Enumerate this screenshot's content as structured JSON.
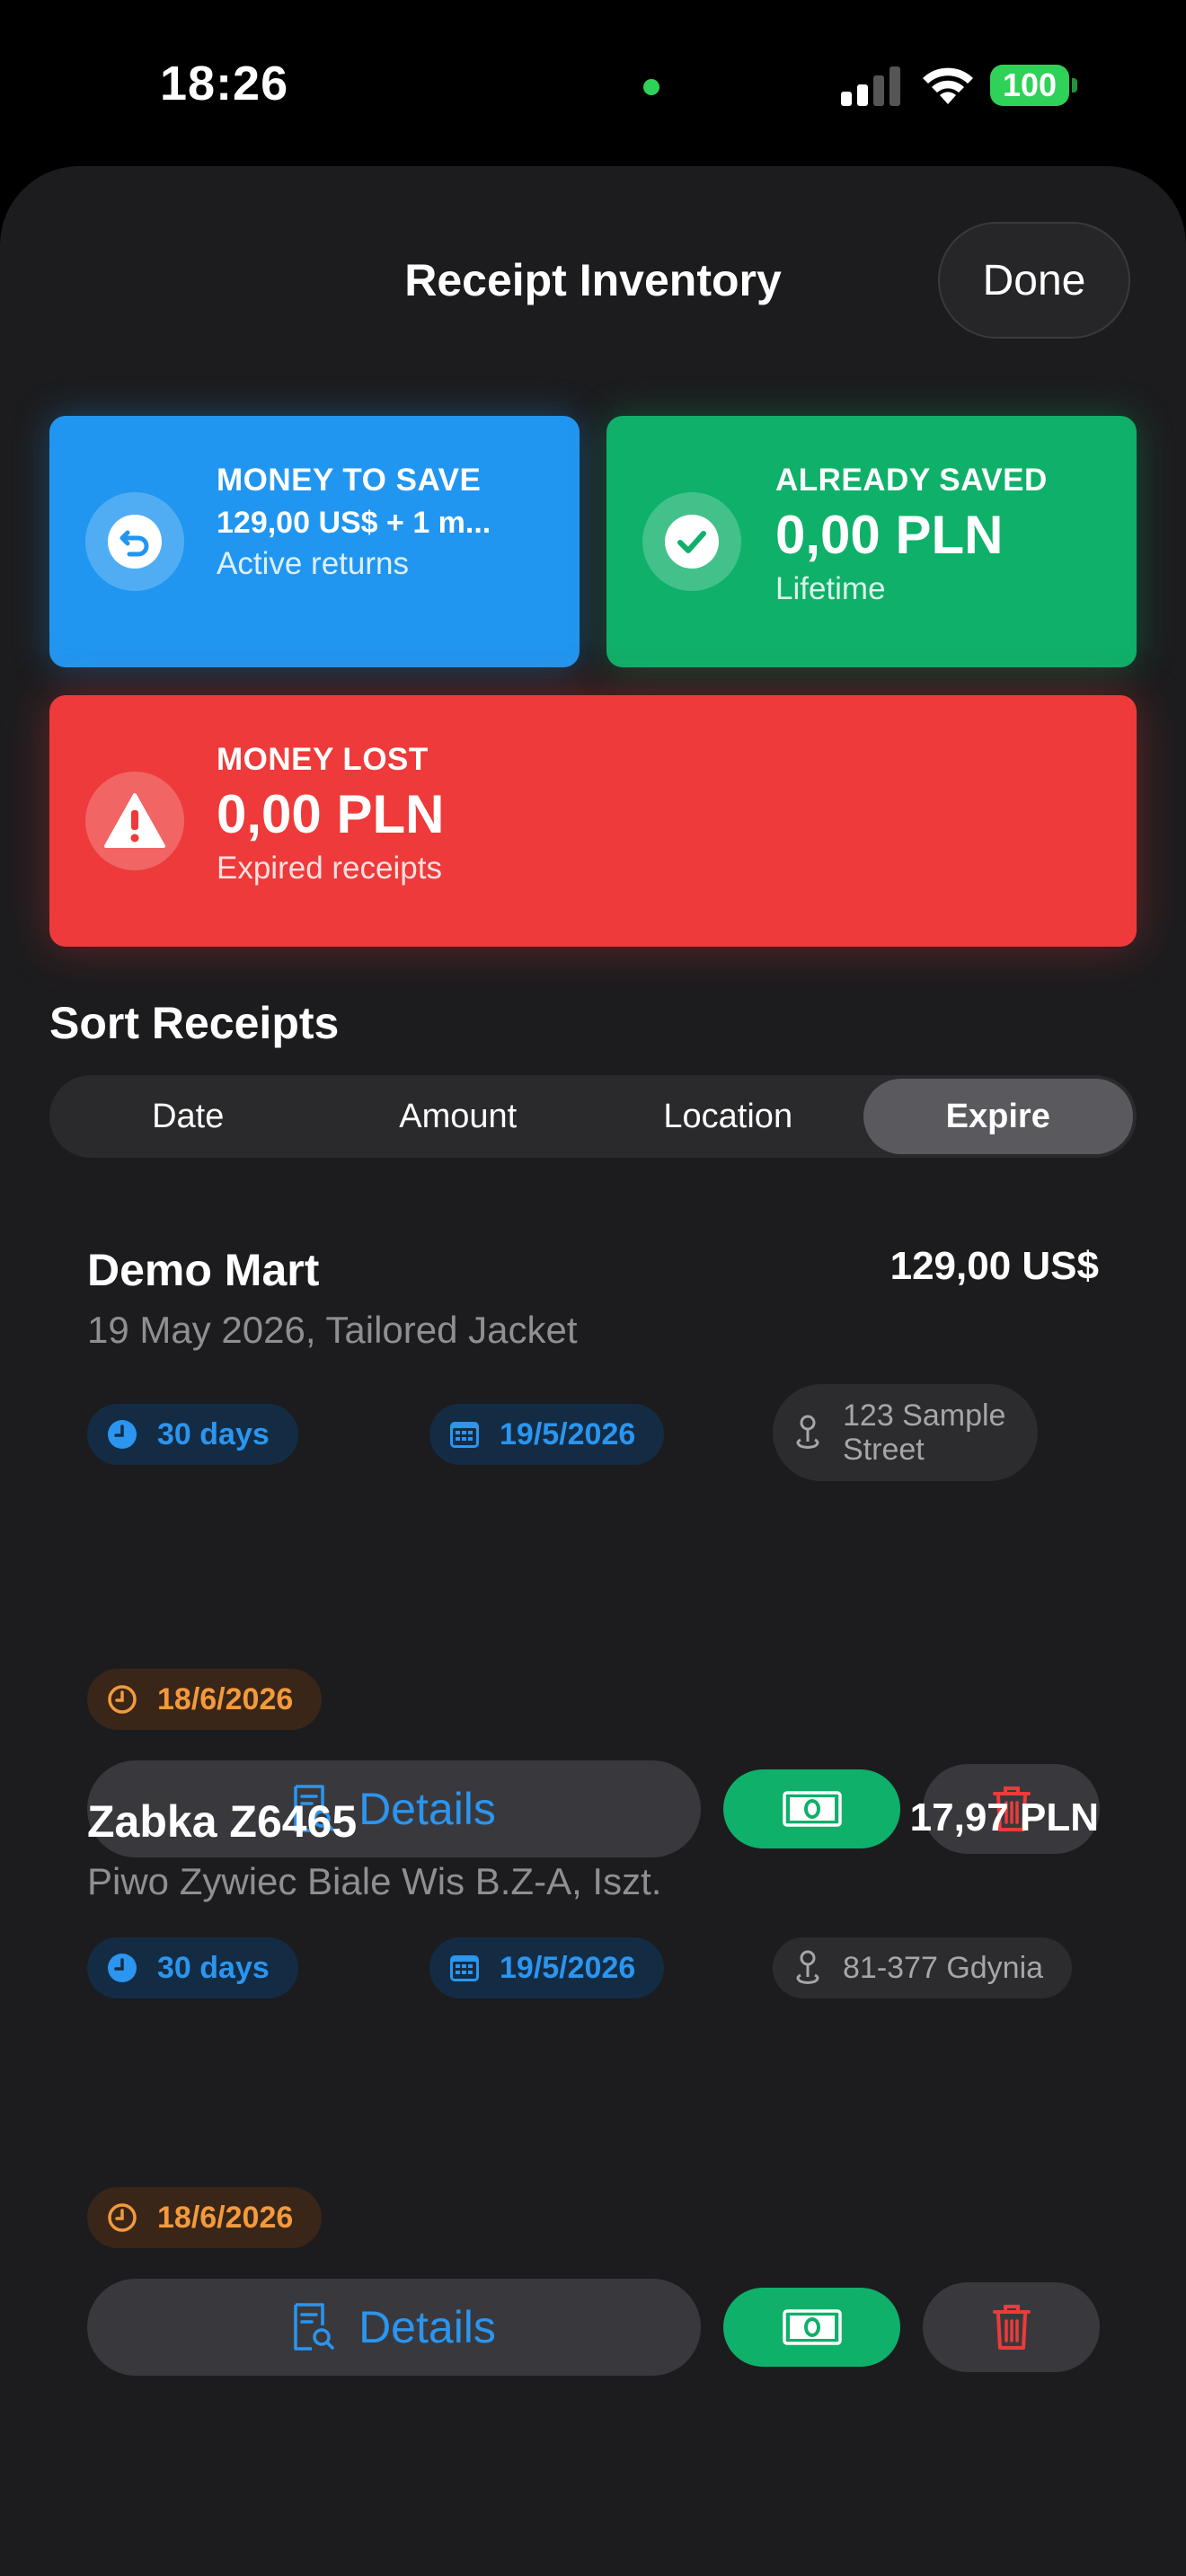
{
  "status_bar": {
    "time": "18:26",
    "battery": "100"
  },
  "header": {
    "title": "Receipt Inventory",
    "done_label": "Done"
  },
  "summary": {
    "money_to_save": {
      "label": "MONEY TO SAVE",
      "value": "129,00 US$ + 1 m...",
      "sub": "Active returns",
      "color": "#2196f0",
      "icon": "return-arrow-icon"
    },
    "already_saved": {
      "label": "ALREADY SAVED",
      "value": "0,00 PLN",
      "sub": "Lifetime",
      "color": "#0fb06a",
      "icon": "checkmark-icon"
    },
    "money_lost": {
      "label": "MONEY LOST",
      "value": "0,00 PLN",
      "sub": "Expired receipts",
      "color": "#ee3a3a",
      "icon": "warning-icon"
    }
  },
  "sort": {
    "title": "Sort Receipts",
    "options": [
      "Date",
      "Amount",
      "Location",
      "Expire"
    ],
    "selected": "Expire"
  },
  "receipts": [
    {
      "store": "Demo Mart",
      "amount": "129,00 US$",
      "description": "19 May 2026, Tailored Jacket",
      "return_window": "30 days",
      "purchase_date": "19/5/2026",
      "location_line1": "123 Sample",
      "location_line2": "Street",
      "expire_date": "18/6/2026",
      "details_label": "Details"
    },
    {
      "store": "Zabka Z6465",
      "amount": "17,97 PLN",
      "description": "Piwo Zywiec Biale Wis B.Z-A, Iszt.",
      "return_window": "30 days",
      "purchase_date": "19/5/2026",
      "location_line1": "81-377 Gdynia",
      "expire_date": "18/6/2026",
      "details_label": "Details"
    }
  ],
  "colors": {
    "accent_blue": "#2b95ef",
    "accent_orange": "#f39a3c",
    "accent_green": "#0fb06a",
    "trash_red": "#ee3a3a"
  }
}
